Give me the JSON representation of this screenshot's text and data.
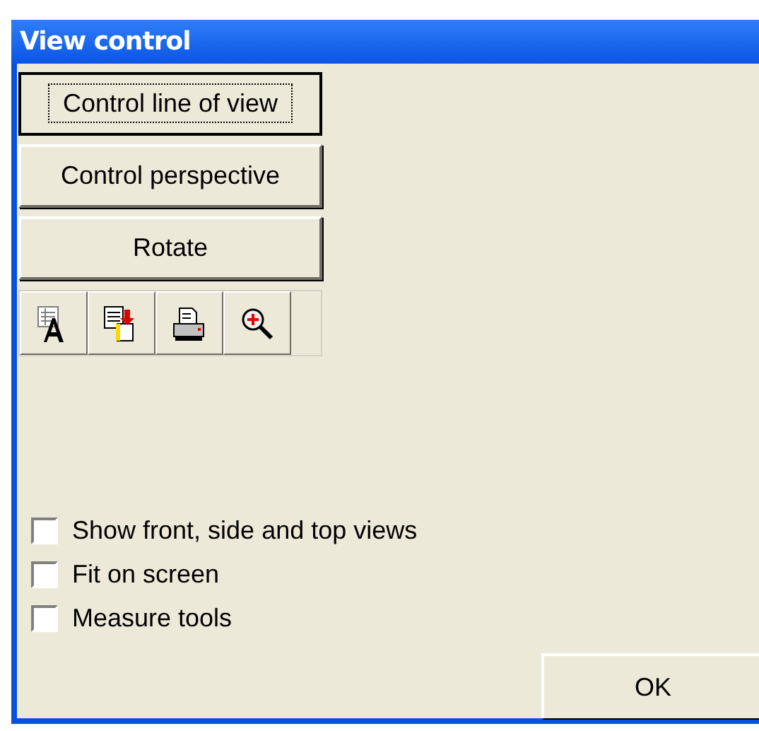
{
  "window": {
    "title": "View control"
  },
  "buttons": [
    {
      "label": "Control line of view",
      "focused": true
    },
    {
      "label": "Control perspective",
      "focused": false
    },
    {
      "label": "Rotate",
      "focused": false
    }
  ],
  "toolbar": [
    {
      "kind": "font"
    },
    {
      "kind": "paste"
    },
    {
      "kind": "print"
    },
    {
      "kind": "zoom"
    }
  ],
  "checkboxes": [
    {
      "label": "Show front, side and top views",
      "checked": false
    },
    {
      "label": "Fit on screen",
      "checked": false
    },
    {
      "label": "Measure tools",
      "checked": false
    }
  ],
  "ok_button": "OK"
}
